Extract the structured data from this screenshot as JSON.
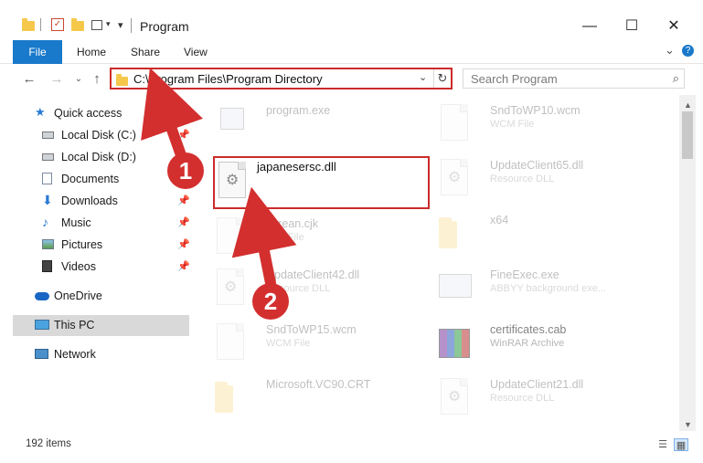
{
  "window": {
    "title": "Program",
    "minimize_icon": "minimize-icon",
    "maximize_icon": "maximize-icon",
    "close_icon": "close-icon"
  },
  "ribbon": {
    "tabs": [
      "File",
      "Home",
      "Share",
      "View"
    ],
    "expand_icon": "chevron-down-icon",
    "help_icon": "help-icon"
  },
  "address": {
    "path": "C:\\Program Files\\Program Directory",
    "search_placeholder": "Search Program"
  },
  "sidebar": {
    "items": [
      {
        "label": "Quick access",
        "icon": "star-icon",
        "pinned": false
      },
      {
        "label": "Local Disk (C:)",
        "icon": "drive-icon",
        "pinned": true
      },
      {
        "label": "Local Disk (D:)",
        "icon": "drive-icon",
        "pinned": false
      },
      {
        "label": "Documents",
        "icon": "documents-icon",
        "pinned": false
      },
      {
        "label": "Downloads",
        "icon": "downloads-icon",
        "pinned": true
      },
      {
        "label": "Music",
        "icon": "music-icon",
        "pinned": true
      },
      {
        "label": "Pictures",
        "icon": "pictures-icon",
        "pinned": true
      },
      {
        "label": "Videos",
        "icon": "videos-icon",
        "pinned": true
      },
      {
        "label": "OneDrive",
        "icon": "cloud-icon",
        "pinned": false
      },
      {
        "label": "This PC",
        "icon": "computer-icon",
        "pinned": false,
        "selected": true
      },
      {
        "label": "Network",
        "icon": "network-icon",
        "pinned": false
      }
    ]
  },
  "files": {
    "left": [
      {
        "name": "program.exe",
        "sub": ""
      },
      {
        "name": "japanesersc.dll",
        "sub": "",
        "highlighted": true
      },
      {
        "name": "korean.cjk",
        "sub": "CJK File"
      },
      {
        "name": "UpdateClient42.dll",
        "sub": "Resource DLL"
      },
      {
        "name": "SndToWP15.wcm",
        "sub": "WCM File"
      },
      {
        "name": "Microsoft.VC90.CRT",
        "sub": ""
      }
    ],
    "right": [
      {
        "name": "SndToWP10.wcm",
        "sub": "WCM File"
      },
      {
        "name": "UpdateClient65.dll",
        "sub": "Resource DLL"
      },
      {
        "name": "x64",
        "sub": ""
      },
      {
        "name": "FineExec.exe",
        "sub": "ABBYY background exe..."
      },
      {
        "name": "certificates.cab",
        "sub": "WinRAR Archive"
      },
      {
        "name": "UpdateClient21.dll",
        "sub": "Resource DLL"
      }
    ]
  },
  "status": {
    "items_text": "192 items"
  },
  "annotations": {
    "step1": "1",
    "step2": "2",
    "color": "#d32f2f"
  }
}
